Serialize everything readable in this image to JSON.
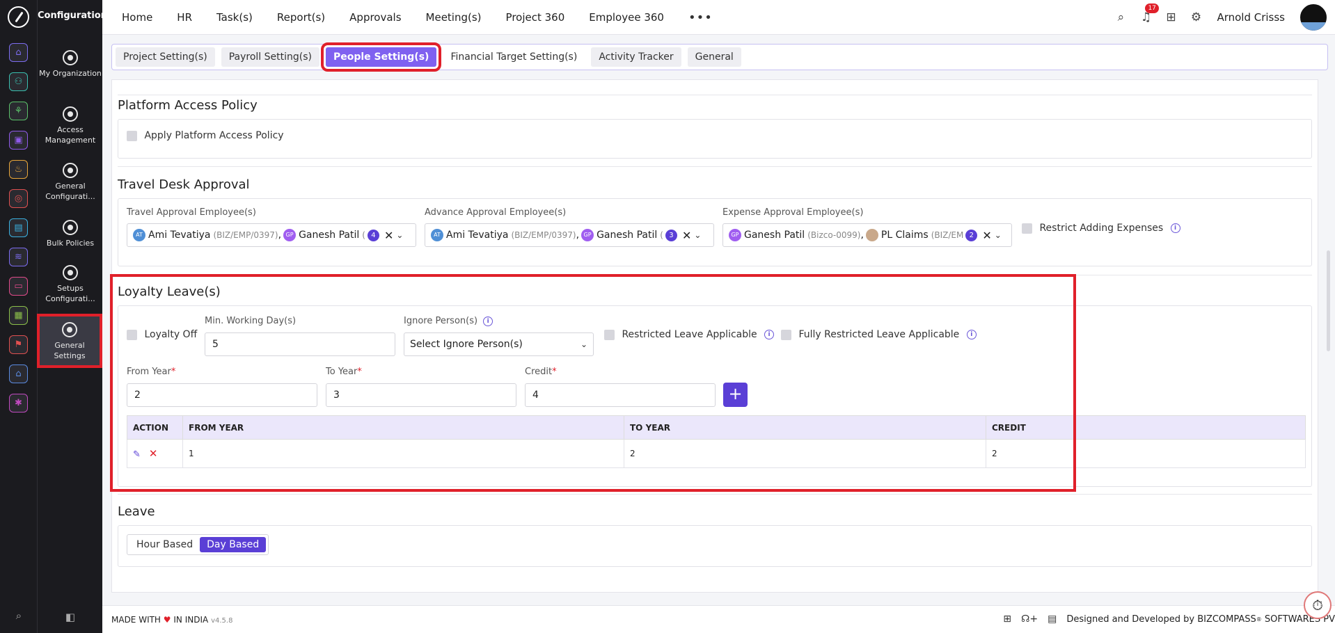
{
  "sidebar": {
    "title": "Configuration",
    "items": [
      {
        "label": "My Organization"
      },
      {
        "label": "Access Management"
      },
      {
        "label": "General Configurati..."
      },
      {
        "label": "Bulk Policies"
      },
      {
        "label": "Setups Configurati..."
      },
      {
        "label": "General Settings"
      }
    ]
  },
  "rail_colors": [
    "#7c6cf0",
    "#3ac0b0",
    "#5bc06a",
    "#8f5ae8",
    "#e8a63a",
    "#e05050",
    "#3ab0e0",
    "#7c6cf0",
    "#e04a8a",
    "#8cc04a",
    "#e05050",
    "#5a8ae0",
    "#c04ac0"
  ],
  "nav": [
    "Home",
    "HR",
    "Task(s)",
    "Report(s)",
    "Approvals",
    "Meeting(s)",
    "Project 360",
    "Employee 360"
  ],
  "header": {
    "notifications": "17",
    "username": "Arnold Crisss"
  },
  "tabs": [
    "Project Setting(s)",
    "Payroll Setting(s)",
    "People Setting(s)",
    "Financial Target Setting(s)",
    "Activity Tracker",
    "General"
  ],
  "platform": {
    "title": "Platform Access Policy",
    "checkbox": "Apply Platform Access Policy"
  },
  "travel": {
    "title": "Travel Desk Approval",
    "travel_label": "Travel Approval Employee(s)",
    "advance_label": "Advance Approval Employee(s)",
    "expense_label": "Expense Approval Employee(s)",
    "restrict_label": "Restrict Adding Expenses",
    "travel_chips": {
      "name1": "Ami Tevatiya",
      "code1": "(BIZ/EMP/0397)",
      "name2": "Ganesh Patil",
      "code2": "(",
      "count": "4"
    },
    "advance_chips": {
      "name1": "Ami Tevatiya",
      "code1": "(BIZ/EMP/0397)",
      "name2": "Ganesh Patil",
      "code2": "(",
      "count": "3"
    },
    "expense_chips": {
      "name1": "Ganesh Patil",
      "code1": "(Bizco-0099)",
      "name2": "PL Claims",
      "code2": "(BIZ/EM",
      "count": "2"
    }
  },
  "loyalty": {
    "title": "Loyalty Leave(s)",
    "off_label": "Loyalty Off",
    "min_label": "Min. Working Day(s)",
    "min_value": "5",
    "ignore_label": "Ignore Person(s)",
    "ignore_placeholder": "Select Ignore Person(s)",
    "restricted_label": "Restricted Leave Applicable",
    "fully_label": "Fully Restricted Leave Applicable",
    "from_label": "From Year",
    "to_label": "To Year",
    "credit_label": "Credit",
    "from_value": "2",
    "to_value": "3",
    "credit_value": "4",
    "table": {
      "headers": [
        "ACTION",
        "FROM YEAR",
        "TO YEAR",
        "CREDIT"
      ],
      "rows": [
        {
          "from": "1",
          "to": "2",
          "credit": "2"
        }
      ]
    }
  },
  "leave": {
    "title": "Leave",
    "options": [
      "Hour Based",
      "Day Based"
    ],
    "selected": "Day Based"
  },
  "footer": {
    "made_with": "MADE WITH",
    "in_india": "IN INDIA",
    "version": "v4.5.8",
    "designed": "Designed and Developed by",
    "company": "BIZCOMPASS",
    "company_rest": "SOFTWARES PV"
  }
}
